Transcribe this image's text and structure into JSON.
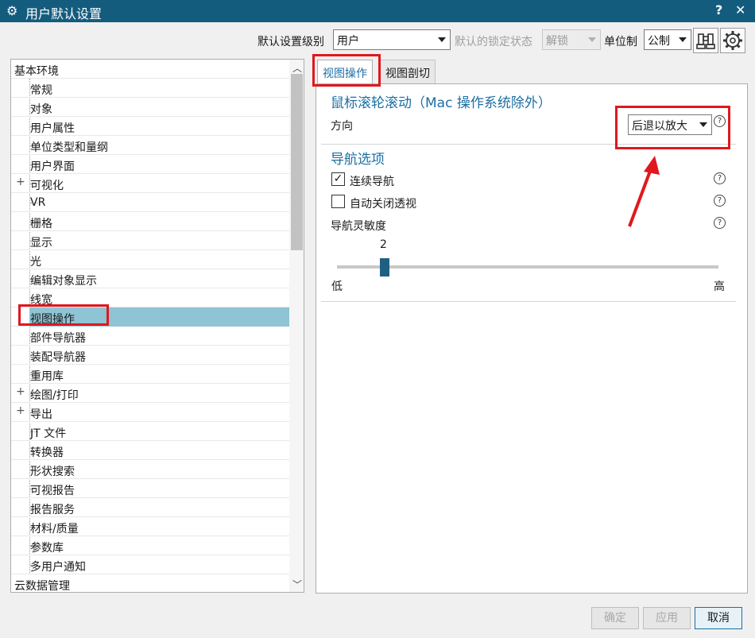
{
  "window": {
    "title": "用户默认设置",
    "help_glyph": "?",
    "close_glyph": "✕"
  },
  "top": {
    "level_label": "默认设置级别",
    "level_value": "用户",
    "lock_label": "默认的锁定状态",
    "lock_value": "解锁",
    "unit_label": "单位制",
    "unit_value": "公制"
  },
  "tree": {
    "root": "基本环境",
    "items": [
      {
        "label": "常规",
        "expandable": false
      },
      {
        "label": "对象",
        "expandable": false
      },
      {
        "label": "用户属性",
        "expandable": false
      },
      {
        "label": "单位类型和量纲",
        "expandable": false
      },
      {
        "label": "用户界面",
        "expandable": false
      },
      {
        "label": "可视化",
        "expandable": true
      },
      {
        "label": "VR",
        "expandable": false
      },
      {
        "label": "栅格",
        "expandable": false
      },
      {
        "label": "显示",
        "expandable": false
      },
      {
        "label": "光",
        "expandable": false
      },
      {
        "label": "编辑对象显示",
        "expandable": false
      },
      {
        "label": "线宽",
        "expandable": false
      },
      {
        "label": "视图操作",
        "expandable": false,
        "selected": true
      },
      {
        "label": "部件导航器",
        "expandable": false
      },
      {
        "label": "装配导航器",
        "expandable": false
      },
      {
        "label": "重用库",
        "expandable": false
      },
      {
        "label": "绘图/打印",
        "expandable": true
      },
      {
        "label": "导出",
        "expandable": true
      },
      {
        "label": "JT 文件",
        "expandable": false
      },
      {
        "label": "转换器",
        "expandable": false
      },
      {
        "label": "形状搜索",
        "expandable": false
      },
      {
        "label": "可视报告",
        "expandable": false
      },
      {
        "label": "报告服务",
        "expandable": false
      },
      {
        "label": "材料/质量",
        "expandable": false
      },
      {
        "label": "参数库",
        "expandable": false
      },
      {
        "label": "多用户通知",
        "expandable": false
      }
    ],
    "last": "云数据管理"
  },
  "tabs": [
    {
      "label": "视图操作",
      "active": true
    },
    {
      "label": "视图剖切",
      "active": false
    }
  ],
  "panel": {
    "wheel_title": "鼠标滚轮滚动（Mac 操作系统除外）",
    "direction_label": "方向",
    "direction_value": "后退以放大",
    "nav_title": "导航选项",
    "continuous_label": "连续导航",
    "continuous_checked": true,
    "autoclose_label": "自动关闭透视",
    "autoclose_checked": false,
    "sensitivity_label": "导航灵敏度",
    "sensitivity_value": "2",
    "low_label": "低",
    "high_label": "高",
    "help_glyph": "?"
  },
  "buttons": {
    "ok": "确定",
    "apply": "应用",
    "cancel": "取消"
  },
  "colors": {
    "titlebar": "#145c7e",
    "accent": "#1c6fa3",
    "selection": "#8fc4d4",
    "annotation": "#e0181e"
  }
}
